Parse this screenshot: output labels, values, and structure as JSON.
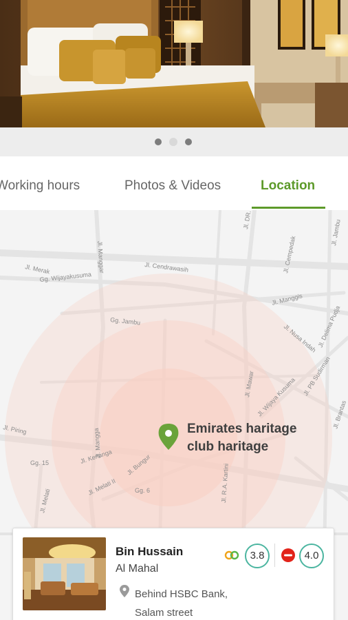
{
  "gallery": {
    "total_slides": 3,
    "active_slide": 2
  },
  "tabs": [
    {
      "label": "Working hours",
      "active": false
    },
    {
      "label": "Photos & Videos",
      "active": false
    },
    {
      "label": "Location",
      "active": true
    }
  ],
  "map": {
    "place_name": "Emirates haritage club haritage",
    "street_labels": [
      "Jl. Mawar",
      "Jl. Merak",
      "Gg. Wijayakusuma",
      "Jl. Cendrawasih",
      "Jl. Manggis",
      "Jl. DR.",
      "Jl. Cempedak",
      "Jl. Jambu",
      "Gg. Jambu",
      "Jl. Nusa Indah",
      "Jl. Delima Pudja",
      "Jl. Wijaya Kusuma",
      "Jl. PB Sudirman",
      "Jl. Brantas",
      "Jl. Piring",
      "Gg. 15",
      "Jl. Kenanga",
      "Jl. Bungur",
      "Jl. Melati II",
      "Gg. 6",
      "Jl. Melati",
      "Jl. R.A. Kartini",
      "Jl. Manggar",
      "Jl. Mangga"
    ],
    "colors": {
      "radius": "#f9cfc3",
      "pin": "#6aa33a"
    }
  },
  "card": {
    "name": "Bin Hussain",
    "subtitle": "Al Mahal",
    "address": "Behind HSBC Bank, Salam street",
    "ratings": [
      {
        "icon": "tripadvisor-icon",
        "value": "3.8"
      },
      {
        "icon": "zomato-icon",
        "value": "4.0"
      }
    ]
  },
  "colors": {
    "accent": "#5d9a2a",
    "badge_ring": "#4bb5a0"
  }
}
